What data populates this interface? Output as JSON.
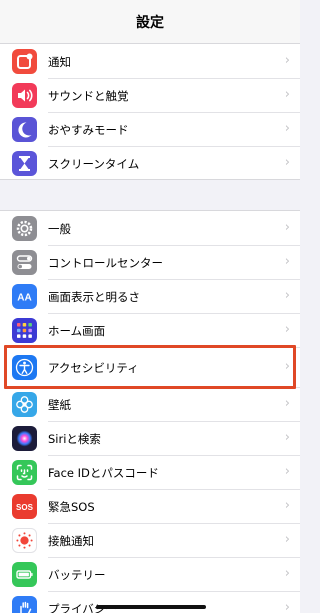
{
  "header": {
    "title": "設定"
  },
  "group1": [
    {
      "label": "通知",
      "icon": "notifications-icon",
      "color": "#f14b3d"
    },
    {
      "label": "サウンドと触覚",
      "icon": "sound-icon",
      "color": "#f23a59"
    },
    {
      "label": "おやすみモード",
      "icon": "moon-icon",
      "color": "#5a54d6"
    },
    {
      "label": "スクリーンタイム",
      "icon": "hourglass-icon",
      "color": "#5b55d9"
    }
  ],
  "group2": [
    {
      "label": "一般",
      "icon": "gear-icon",
      "color": "#8e8e93"
    },
    {
      "label": "コントロールセンター",
      "icon": "control-center-icon",
      "color": "#8e8e93"
    },
    {
      "label": "画面表示と明るさ",
      "icon": "display-brightness-icon",
      "color": "#2f7cf6"
    },
    {
      "label": "ホーム画面",
      "icon": "home-screen-icon",
      "color": "#3c3ad4"
    },
    {
      "label": "アクセシビリティ",
      "icon": "accessibility-icon",
      "color": "#1d78f2"
    },
    {
      "label": "壁紙",
      "icon": "wallpaper-icon",
      "color": "#36a7e8"
    },
    {
      "label": "Siriと検索",
      "icon": "siri-icon",
      "color": "#1c1c3a"
    },
    {
      "label": "Face IDとパスコード",
      "icon": "face-id-icon",
      "color": "#35c759"
    },
    {
      "label": "緊急SOS",
      "icon": "sos-icon",
      "color": "#ea3b2f"
    },
    {
      "label": "接触通知",
      "icon": "exposure-notification-icon",
      "color": "#ffffff"
    },
    {
      "label": "バッテリー",
      "icon": "battery-icon",
      "color": "#35c759"
    },
    {
      "label": "プライバシー",
      "icon": "privacy-hand-icon",
      "color": "#2f7cf6"
    }
  ],
  "chevron": "›",
  "sos_text": "SOS",
  "aa_text": "AA"
}
